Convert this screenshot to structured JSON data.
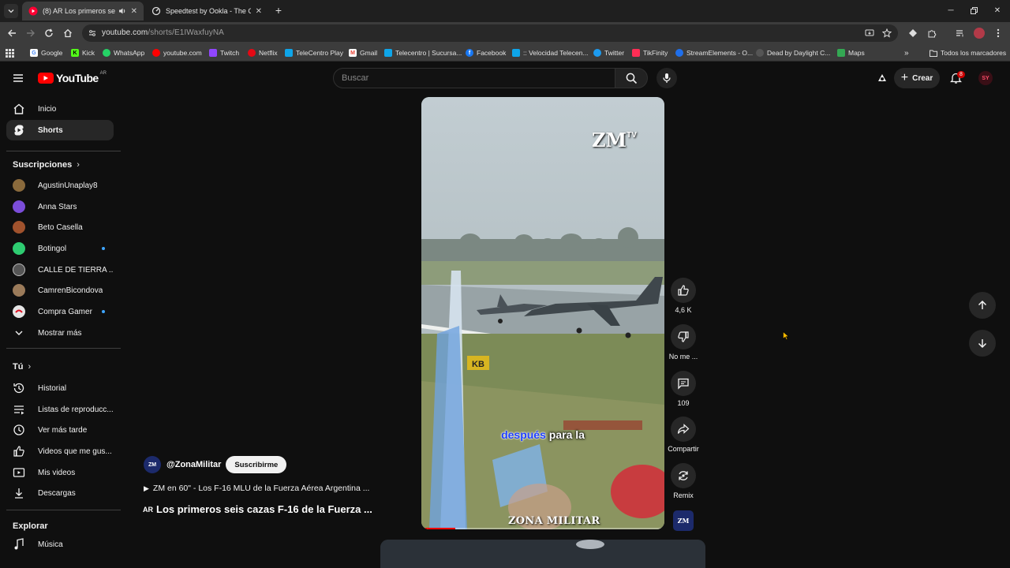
{
  "browser": {
    "tabs": [
      {
        "title": "(8) AR Los primeros seis caza",
        "active": true
      },
      {
        "title": "Speedtest by Ookla - The Globa",
        "active": false
      }
    ],
    "url_host": "youtube.com",
    "url_path": "/shorts/E1IWaxfuyNA",
    "bookmarks": [
      "Google",
      "Kick",
      "WhatsApp",
      "youtube.com",
      "Twitch",
      "Netflix",
      "TeleCentro Play",
      "Gmail",
      "Telecentro | Sucursa...",
      "Facebook",
      ":: Velocidad Telecen...",
      "Twitter",
      "TikFinity",
      "StreamElements - O...",
      "Dead by Daylight C...",
      "Maps"
    ],
    "bookmarks_all": "Todos los marcadores"
  },
  "youtube": {
    "logo_text": "YouTube",
    "country": "AR",
    "search_placeholder": "Buscar",
    "create_label": "Crear",
    "notification_count": "8",
    "avatar_text": "SY"
  },
  "sidebar": {
    "main": [
      {
        "label": "Inicio",
        "icon": "home-icon"
      },
      {
        "label": "Shorts",
        "icon": "shorts-icon"
      }
    ],
    "subs_heading": "Suscripciones",
    "subscriptions": [
      {
        "label": "AgustinUnaplay8",
        "color": "#8a6a3c",
        "dot": false
      },
      {
        "label": "Anna Stars",
        "color": "#7b4dd9",
        "dot": false
      },
      {
        "label": "Beto Casella",
        "color": "#a0522d",
        "dot": false
      },
      {
        "label": "Botingol",
        "color": "#2ecc71",
        "dot": true
      },
      {
        "label": "CALLE DE TIERRA ...",
        "color": "#555555",
        "dot": false
      },
      {
        "label": "CamrenBicondova",
        "color": "#9b7b5a",
        "dot": false
      },
      {
        "label": "Compra Gamer",
        "color": "#e5e5e5",
        "dot": true
      }
    ],
    "show_more": "Mostrar más",
    "you_heading": "Tú",
    "you_items": [
      {
        "label": "Historial",
        "icon": "history-icon"
      },
      {
        "label": "Listas de reproducc...",
        "icon": "playlists-icon"
      },
      {
        "label": "Ver más tarde",
        "icon": "watch-later-icon"
      },
      {
        "label": "Videos que me gus...",
        "icon": "liked-icon"
      },
      {
        "label": "Mis videos",
        "icon": "my-videos-icon"
      },
      {
        "label": "Descargas",
        "icon": "downloads-icon"
      }
    ],
    "explore_heading": "Explorar",
    "explore_items": [
      {
        "label": "Música",
        "icon": "music-icon"
      }
    ]
  },
  "short": {
    "logo": "ZM",
    "logo_tv": "TV",
    "subtitle_highlight": "después",
    "subtitle_rest": " para la",
    "watermark": "ZONA MILITAR",
    "runway_sign": "KB",
    "progress": 0.14,
    "likes": "4,6 K",
    "dislike_label": "No me ...",
    "comments": "109",
    "share_label": "Compartir",
    "remix_label": "Remix",
    "channel_thumb": "ZM",
    "channel_handle": "@ZonaMilitar",
    "subscribe_label": "Suscribirme",
    "playlist": "ZM en 60\" - Los F-16 MLU de la Fuerza Aérea Argentina ...",
    "title_flag": "AR",
    "title": "Los primeros seis cazas F-16 de la Fuerza ..."
  }
}
